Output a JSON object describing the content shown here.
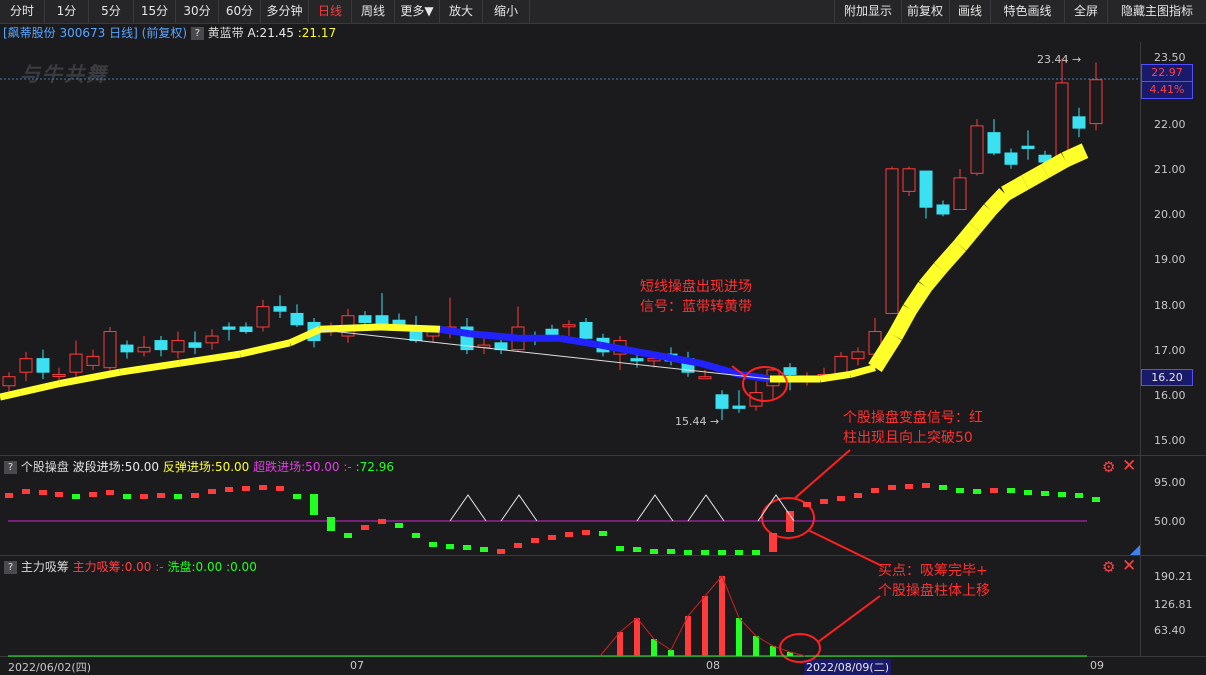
{
  "toolbar": {
    "left": [
      "分时",
      "1分",
      "5分",
      "15分",
      "30分",
      "60分",
      "多分钟",
      "日线",
      "周线",
      "更多▼",
      "放大",
      "缩小"
    ],
    "active_label": "日线",
    "right": [
      "附加显示",
      "前复权",
      "画线",
      "特色画线",
      "全屏",
      "隐藏主图指标"
    ]
  },
  "info": {
    "stock": "[飙蒂股份 300673 日线]",
    "adjust": "(前复权)",
    "question": "?",
    "indicator_label": "黄蓝带",
    "value_a": "A:21.45",
    "value_b": ":21.17"
  },
  "watermark": "与牛共舞",
  "main_axis": {
    "ticks": [
      "23.50",
      "22.00",
      "21.00",
      "20.00",
      "19.00",
      "18.00",
      "17.00",
      "16.00",
      "15.00"
    ],
    "current_price": "22.97",
    "change_pct": "4.41%",
    "ref_price": "16.20",
    "high_marker": "23.44",
    "low_marker": "15.44"
  },
  "annotations": {
    "a1_l1": "短线操盘出现进场",
    "a1_l2": "信号：蓝带转黄带",
    "a2_l1": "个股操盘变盘信号：红",
    "a2_l2": "柱出现且向上突破50",
    "a3_l1": "买点：吸筹完毕+",
    "a3_l2": "个股操盘柱体上移"
  },
  "panel1": {
    "name": "个股操盘",
    "v1": "波段进场:50.00",
    "v2": "反弹进场:50.00",
    "v3": "超跌进场:50.00",
    "v4": ":-",
    "v5": ":72.96",
    "ticks": [
      "95.00",
      "50.00"
    ]
  },
  "panel2": {
    "name": "主力吸筹",
    "v1": "主力吸筹:0.00",
    "v2": ":-",
    "v3": "洗盘:0.00",
    "v4": ":0.00",
    "ticks": [
      "190.21",
      "126.81",
      "63.40"
    ]
  },
  "dates": {
    "start": "2022/06/02(四)",
    "m07": "07",
    "m08": "08",
    "cursor": "2022/08/09(二)",
    "m09": "09"
  },
  "colors": {
    "up": "#ff3b3b",
    "down": "#3be1f1",
    "yellow": "#ffff2a",
    "blue": "#2222ff",
    "magenta": "#d024d0",
    "green": "#22ff22"
  }
}
